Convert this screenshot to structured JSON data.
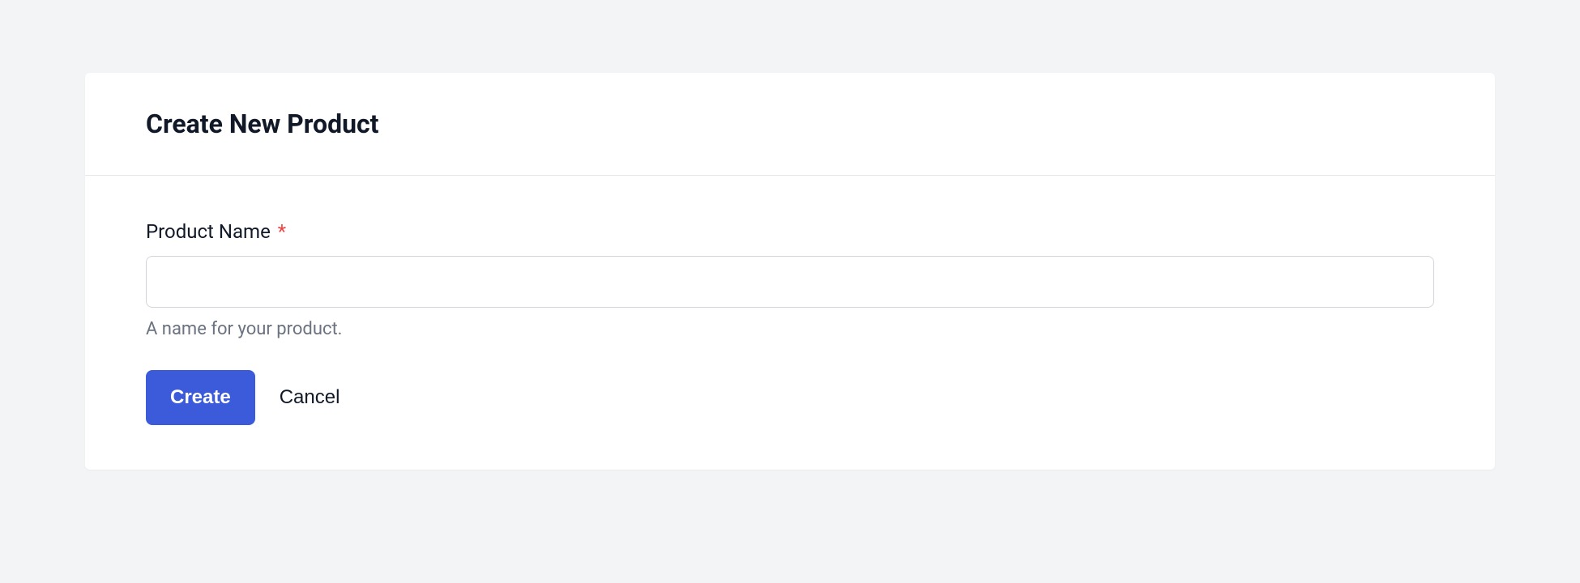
{
  "header": {
    "title": "Create New Product"
  },
  "form": {
    "productName": {
      "label": "Product Name",
      "required": "*",
      "value": "",
      "help": "A name for your product."
    }
  },
  "actions": {
    "create": "Create",
    "cancel": "Cancel"
  }
}
